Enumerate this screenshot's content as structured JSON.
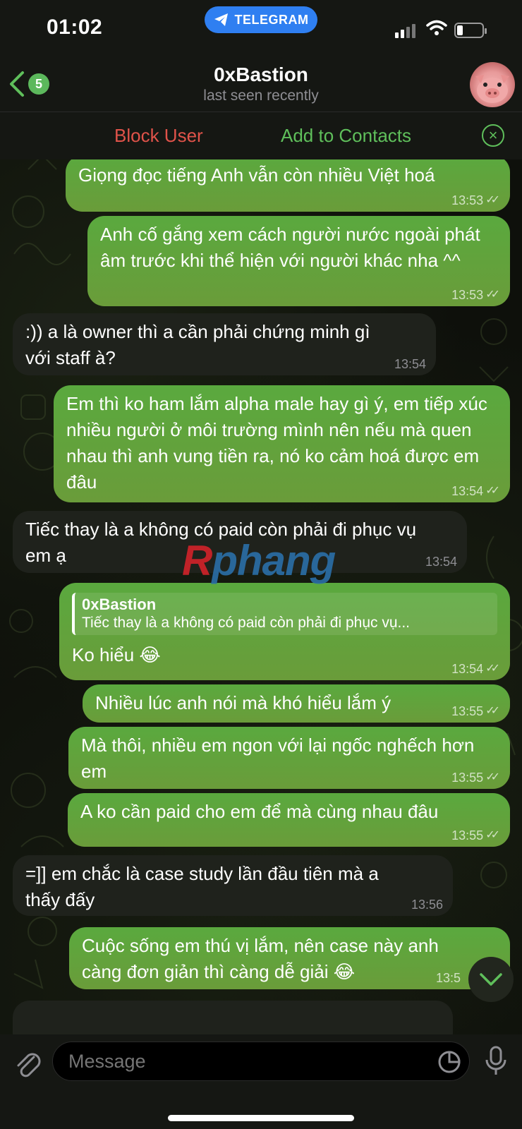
{
  "status_bar": {
    "time": "01:02",
    "app_pill": "TELEGRAM"
  },
  "header": {
    "back_badge": "5",
    "title": "0xBastion",
    "subtitle": "last seen recently"
  },
  "action_bar": {
    "block": "Block User",
    "add": "Add to Contacts"
  },
  "messages": [
    {
      "dir": "out",
      "text": "Giọng đọc tiếng Anh vẫn còn nhiều Việt hoá",
      "time": "13:53"
    },
    {
      "dir": "out",
      "text": "Anh cố gắng xem cách người nước ngoài phát âm trước khi thể hiện với người khác nha ^^",
      "time": "13:53"
    },
    {
      "dir": "in",
      "text": ":)) a là owner thì a cần phải chứng minh gì với staff à?",
      "time": "13:54"
    },
    {
      "dir": "out",
      "text": "Em thì ko ham lắm alpha male hay gì ý, em tiếp xúc nhiều người ở môi trường mình nên nếu mà quen nhau thì anh vung tiền ra, nó ko cảm hoá được em đâu",
      "time": "13:54"
    },
    {
      "dir": "in",
      "text": "Tiếc thay là a không có paid còn phải đi phục vụ em ạ",
      "time": "13:54"
    },
    {
      "dir": "out",
      "quote_name": "0xBastion",
      "quote_text": "Tiếc thay là a không có paid còn phải đi phục vụ...",
      "text": "Ko hiểu 😂",
      "time": "13:54"
    },
    {
      "dir": "out",
      "text": "Nhiều lúc anh nói mà khó hiểu lắm ý",
      "time": "13:55"
    },
    {
      "dir": "out",
      "text": "Mà thôi, nhiều em ngon với lại ngốc nghếch hơn em",
      "time": "13:55"
    },
    {
      "dir": "out",
      "text": "A ko cần paid cho em để mà cùng nhau đâu",
      "time": "13:55"
    },
    {
      "dir": "in",
      "text": "=]] em chắc là case study lần đầu tiên mà a thấy đấy",
      "time": "13:56"
    },
    {
      "dir": "out",
      "text": "Cuộc sống em thú vị lắm, nên case này anh càng đơn giản thì càng dễ giải 😂",
      "time": "13:5"
    }
  ],
  "watermark": {
    "r": "R",
    "rest": "phang"
  },
  "input": {
    "placeholder": "Message"
  },
  "colors": {
    "outgoing_bubble": "#5aa93e",
    "incoming_bubble": "#1f221c",
    "accent_green": "#5fbf5b",
    "block_red": "#e0534a",
    "telegram_blue": "#2f7ff1"
  },
  "icons": [
    "chevron-left-icon",
    "telegram-icon",
    "signal-icon",
    "wifi-icon",
    "battery-icon",
    "close-circle-icon",
    "paperclip-icon",
    "sticker-icon",
    "microphone-icon",
    "chevron-down-icon"
  ]
}
